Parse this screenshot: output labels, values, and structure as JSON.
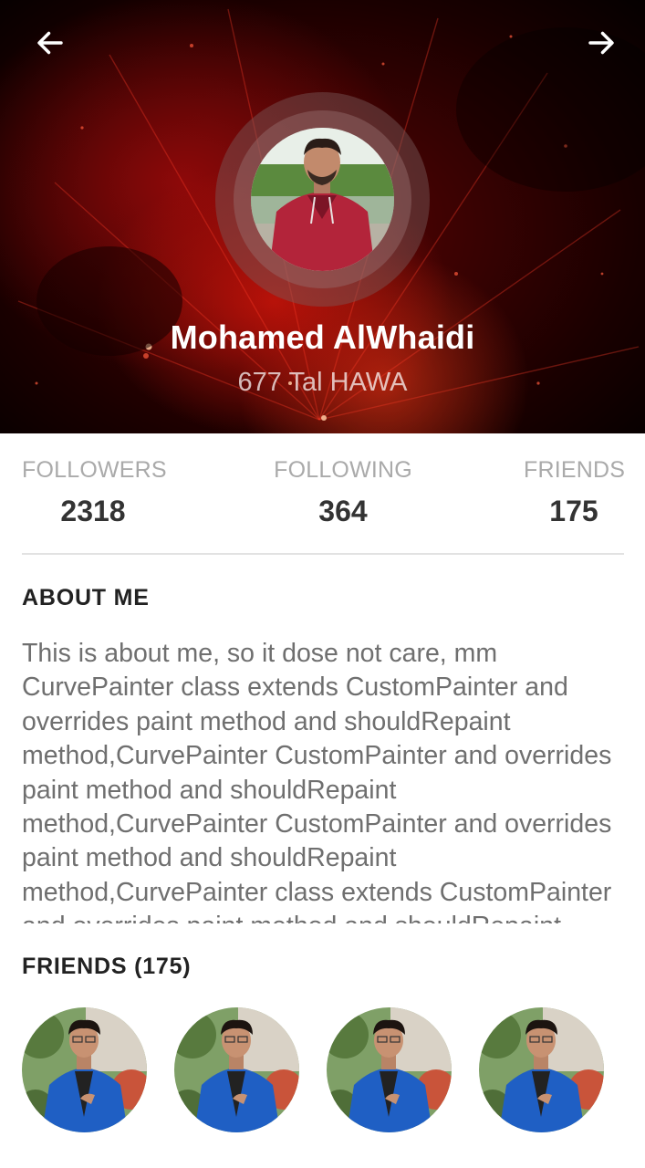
{
  "header": {
    "back_icon": "arrow-left-icon",
    "forward_icon": "arrow-right-icon",
    "name": "Mohamed AlWhaidi",
    "location": "677 Tal HAWA"
  },
  "stats": [
    {
      "label": "FOLLOWERS",
      "value": "2318"
    },
    {
      "label": "FOLLOWING",
      "value": "364"
    },
    {
      "label": "FRIENDS",
      "value": "175"
    }
  ],
  "about": {
    "title": "ABOUT ME",
    "text": "This is about me, so it dose not care, mm CurvePainter class extends CustomPainter and overrides paint method and shouldRepaint method,CurvePainter CustomPainter and overrides paint method and shouldRepaint method,CurvePainter CustomPainter and overrides paint method and shouldRepaint method,CurvePainter class extends CustomPainter and overrides paint method and shouldRepaint method"
  },
  "friends": {
    "title": "FRIENDS (175)",
    "count": 4
  },
  "colors": {
    "header_red": "#8a0a06",
    "text_gray": "#6f6f6f",
    "label_gray": "#aaaaaa",
    "value_dark": "#333333",
    "friend_shirt_blue": "#1f5fc4"
  }
}
